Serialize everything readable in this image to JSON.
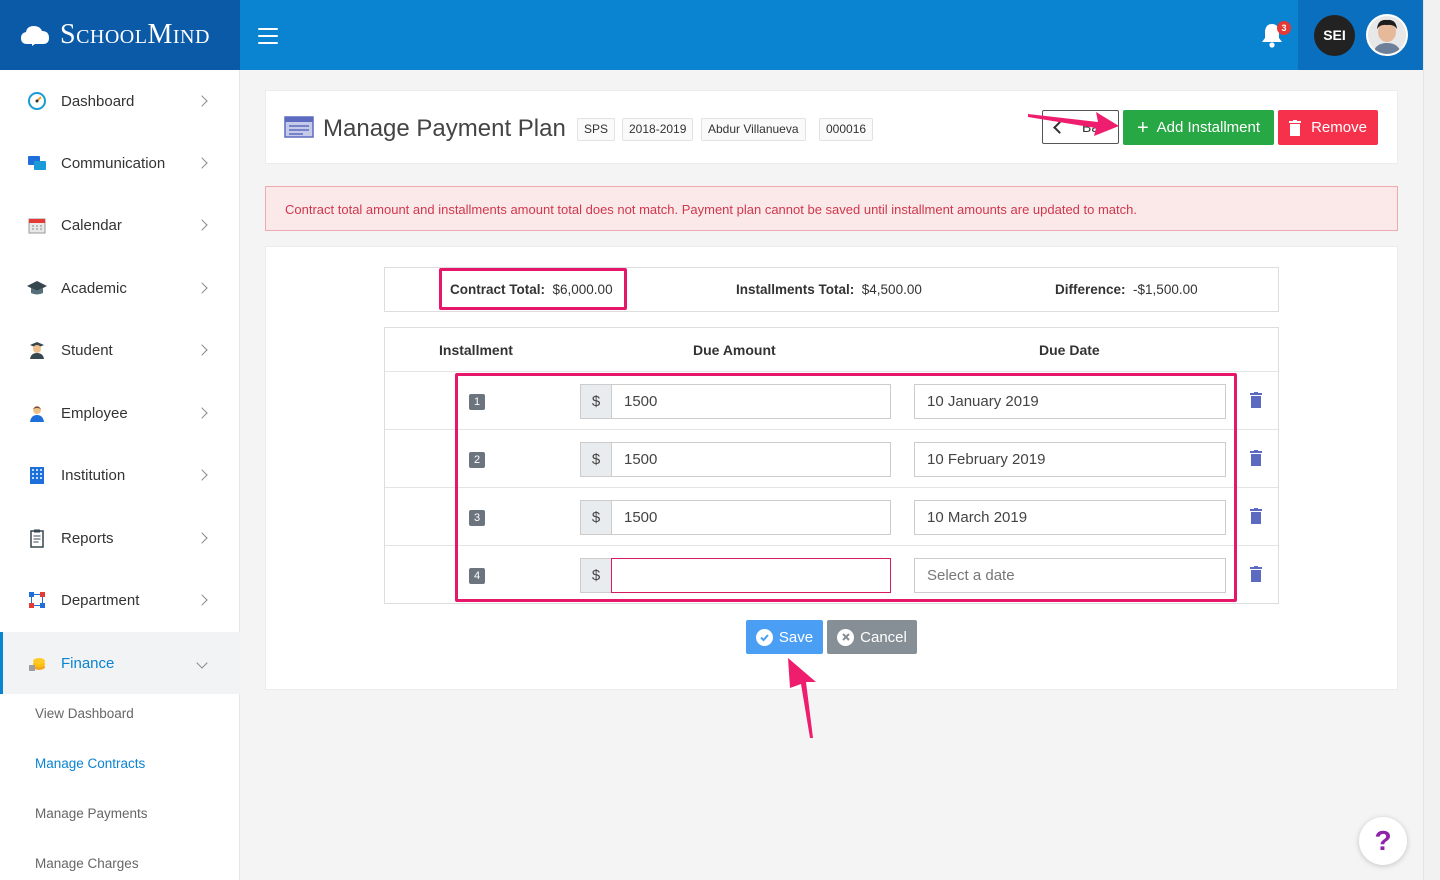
{
  "app": {
    "logo_text": "SchoolMind"
  },
  "header": {
    "notification_count": "3",
    "user_initials": "SEI"
  },
  "sidebar": {
    "items": [
      {
        "label": "Dashboard"
      },
      {
        "label": "Communication"
      },
      {
        "label": "Calendar"
      },
      {
        "label": "Academic"
      },
      {
        "label": "Student"
      },
      {
        "label": "Employee"
      },
      {
        "label": "Institution"
      },
      {
        "label": "Reports"
      },
      {
        "label": "Department"
      },
      {
        "label": "Finance"
      }
    ],
    "finance_sub": [
      {
        "label": "View Dashboard"
      },
      {
        "label": "Manage Contracts"
      },
      {
        "label": "Manage Payments"
      },
      {
        "label": "Manage Charges"
      }
    ]
  },
  "page": {
    "title": "Manage Payment Plan",
    "tags": [
      "SPS",
      "2018-2019",
      "Abdur Villanueva",
      "000016"
    ],
    "back_label": "Ba",
    "add_installment_label": "Add Installment",
    "remove_label": "Remove"
  },
  "alert": {
    "message": "Contract total amount and installments amount total does not match. Payment plan cannot be saved until installment amounts are updated to match."
  },
  "totals": {
    "contract_label": "Contract Total:",
    "contract_value": "$6,000.00",
    "installments_label": "Installments Total:",
    "installments_value": "$4,500.00",
    "difference_label": "Difference:",
    "difference_value": "-$1,500.00"
  },
  "table": {
    "headers": [
      "Installment",
      "Due Amount",
      "Due Date"
    ],
    "currency_symbol": "$",
    "rows": [
      {
        "num": "1",
        "amount": "1500",
        "date": "10 January 2019"
      },
      {
        "num": "2",
        "amount": "1500",
        "date": "10 February 2019"
      },
      {
        "num": "3",
        "amount": "1500",
        "date": "10 March 2019"
      },
      {
        "num": "4",
        "amount": "",
        "date": "",
        "date_placeholder": "Select a date"
      }
    ]
  },
  "actions": {
    "save_label": "Save",
    "cancel_label": "Cancel"
  },
  "help": {
    "label": "?"
  },
  "colors": {
    "brand": "#0a83d1",
    "success": "#28a745",
    "danger": "#f5314b",
    "highlight": "#e6176a"
  }
}
